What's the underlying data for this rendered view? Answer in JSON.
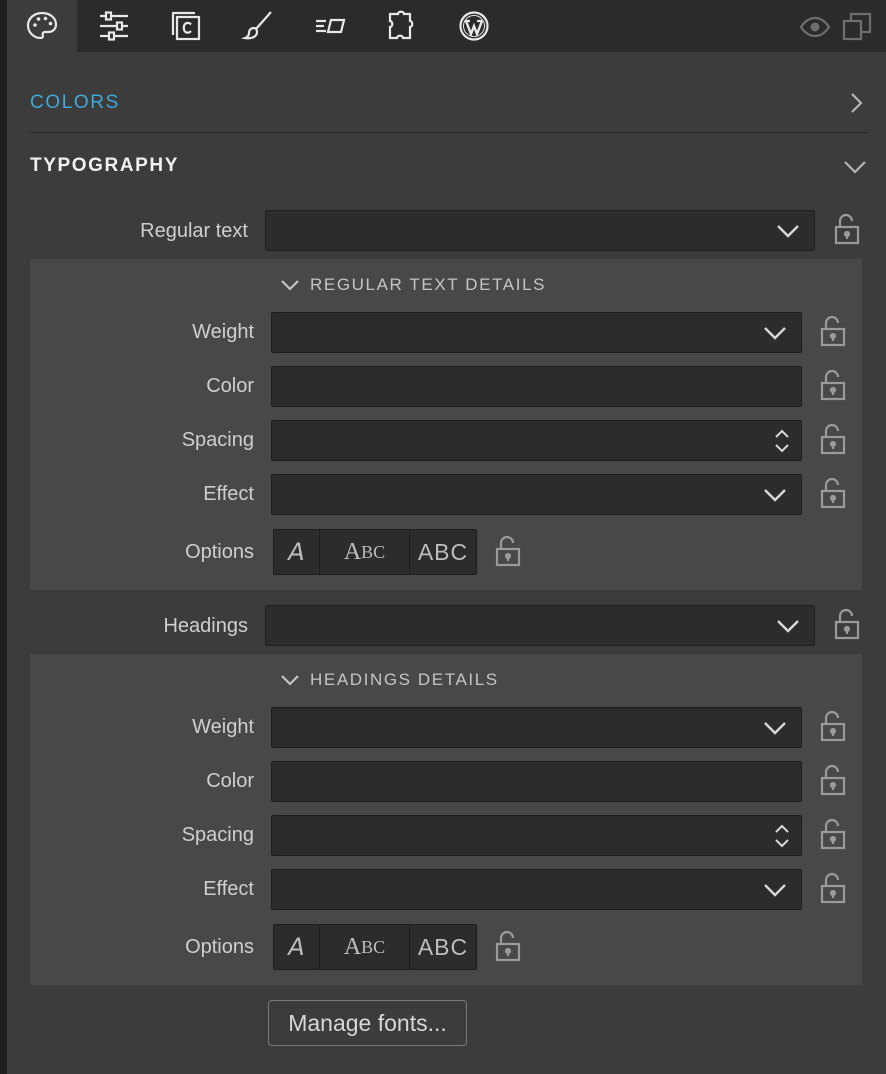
{
  "toolbar": {
    "tools": [
      {
        "icon": "palette-icon"
      },
      {
        "icon": "sliders-icon"
      },
      {
        "icon": "custom-code-icon"
      },
      {
        "icon": "brush-icon"
      },
      {
        "icon": "text-align-icon"
      },
      {
        "icon": "puzzle-icon"
      },
      {
        "icon": "wordpress-icon"
      }
    ],
    "right_icons": [
      "eye-icon",
      "duplicate-icon"
    ]
  },
  "colors_section": {
    "title": "COLORS",
    "color": "#3fa9d8",
    "state": "collapsed"
  },
  "typography_section": {
    "title": "TYPOGRAPHY",
    "state": "expanded",
    "regular_text": {
      "label": "Regular text",
      "value": "",
      "details": {
        "title": "REGULAR TEXT DETAILS",
        "weight": {
          "label": "Weight",
          "value": ""
        },
        "color": {
          "label": "Color",
          "value": ""
        },
        "spacing": {
          "label": "Spacing",
          "value": ""
        },
        "effect": {
          "label": "Effect",
          "value": ""
        },
        "options": {
          "label": "Options",
          "italic": "A",
          "small_caps_big": "A",
          "small_caps_small": "BC",
          "all_caps": "ABC"
        }
      }
    },
    "headings": {
      "label": "Headings",
      "value": "",
      "details": {
        "title": "HEADINGS DETAILS",
        "weight": {
          "label": "Weight",
          "value": ""
        },
        "color": {
          "label": "Color",
          "value": ""
        },
        "spacing": {
          "label": "Spacing",
          "value": ""
        },
        "effect": {
          "label": "Effect",
          "value": ""
        },
        "options": {
          "label": "Options",
          "italic": "A",
          "small_caps_big": "A",
          "small_caps_small": "BC",
          "all_caps": "ABC"
        }
      }
    },
    "manage_fonts_label": "Manage fonts..."
  }
}
